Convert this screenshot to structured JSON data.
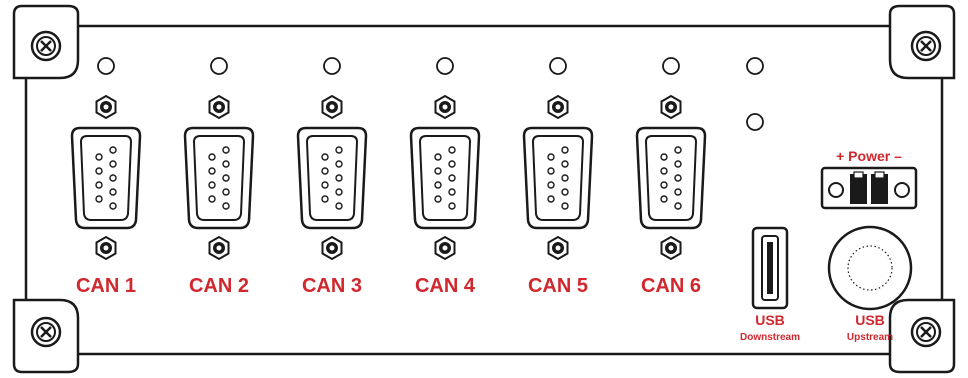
{
  "ports": [
    {
      "label": "CAN 1"
    },
    {
      "label": "CAN 2"
    },
    {
      "label": "CAN 3"
    },
    {
      "label": "CAN 4"
    },
    {
      "label": "CAN 5"
    },
    {
      "label": "CAN 6"
    }
  ],
  "usb_downstream": {
    "title": "USB",
    "subtitle": "Downstream"
  },
  "usb_upstream": {
    "title": "USB",
    "subtitle": "Upstream"
  },
  "power": {
    "label": "+ Power –"
  },
  "colors": {
    "label": "#d0282e",
    "outline": "#1a1a1a"
  },
  "icons": [
    "screw-icon",
    "led-icon",
    "db9-connector-icon",
    "usb-port-icon",
    "power-terminal-icon"
  ]
}
